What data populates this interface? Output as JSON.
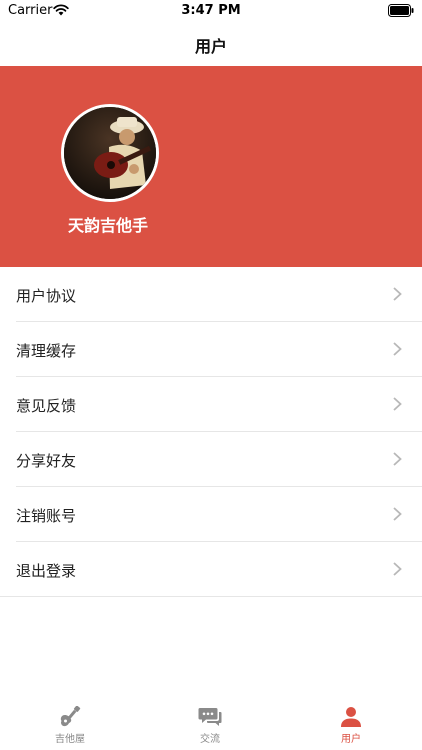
{
  "status_bar": {
    "carrier": "Carrier",
    "time": "3:47 PM"
  },
  "nav": {
    "title": "用户"
  },
  "profile": {
    "username": "天韵吉他手",
    "header_color": "#db5143"
  },
  "menu": [
    {
      "label": "用户协议"
    },
    {
      "label": "清理缓存"
    },
    {
      "label": "意见反馈"
    },
    {
      "label": "分享好友"
    },
    {
      "label": "注销账号"
    },
    {
      "label": "退出登录"
    }
  ],
  "tab_bar": {
    "tabs": [
      {
        "label": "吉他屋",
        "icon": "guitar-icon"
      },
      {
        "label": "交流",
        "icon": "chat-icon"
      },
      {
        "label": "用户",
        "icon": "user-icon",
        "active": true
      }
    ],
    "active_color": "#db5143",
    "inactive_color": "#888888"
  }
}
